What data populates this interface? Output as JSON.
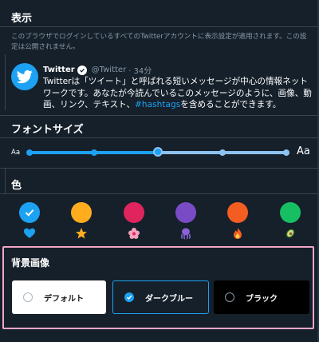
{
  "display": {
    "title": "表示",
    "description": "このブラウザでログインしているすべてのTwitterアカウントに表示設定が適用されます。この設定は公開されません。"
  },
  "tweet": {
    "name": "Twitter",
    "handle": "@Twitter",
    "time": "· 34分",
    "text_before": "Twitterは「ツイート」と呼ばれる短いメッセージが中心の情報ネットワークです。あなたが今読んでいるこのメッセージのように、画像、動画、リンク、テキスト、",
    "hashtag": "#hashtags",
    "text_after": "を含めることができます。"
  },
  "font_size": {
    "title": "フォントサイズ",
    "small_label": "Aa",
    "large_label": "Aa",
    "steps": 5,
    "selected_step": 3
  },
  "color": {
    "title": "色",
    "options": [
      {
        "color": "#1da1f2",
        "icon": "heart-icon",
        "selected": true
      },
      {
        "color": "#ffad1f",
        "icon": "star-icon",
        "selected": false
      },
      {
        "color": "#e0245e",
        "icon": "flower-icon",
        "selected": false
      },
      {
        "color": "#794bc4",
        "icon": "octopus-icon",
        "selected": false
      },
      {
        "color": "#f45d22",
        "icon": "fire-icon",
        "selected": false
      },
      {
        "color": "#17bf63",
        "icon": "avocado-icon",
        "selected": false
      }
    ]
  },
  "background": {
    "title": "背景画像",
    "options": [
      {
        "label": "デフォルト",
        "selected": false
      },
      {
        "label": "ダークブルー",
        "selected": true
      },
      {
        "label": "ブラック",
        "selected": false
      }
    ]
  }
}
